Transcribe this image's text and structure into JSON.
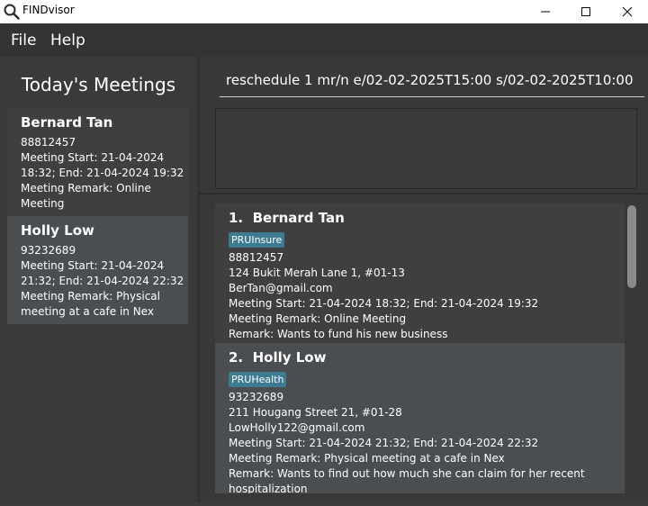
{
  "window": {
    "title": "FINDvisor"
  },
  "menu": {
    "file": "File",
    "help": "Help"
  },
  "meetings": {
    "title": "Today's Meetings",
    "items": [
      {
        "name": "Bernard Tan",
        "phone": "88812457",
        "time_line1": "Meeting Start: 21-04-2024",
        "time_line2": "18:32; End: 21-04-2024 19:32",
        "remark_line1": "Meeting Remark: Online",
        "remark_line2": "Meeting"
      },
      {
        "name": "Holly Low",
        "phone": "93232689",
        "time_line1": "Meeting Start: 21-04-2024",
        "time_line2": "21:32; End: 21-04-2024 22:32",
        "remark_line1": "Meeting Remark: Physical",
        "remark_line2": "meeting at a cafe in Nex"
      }
    ]
  },
  "command": {
    "value": "reschedule 1 mr/n e/02-02-2025T15:00 s/02-02-2025T10:00"
  },
  "result": {
    "text": ""
  },
  "persons": [
    {
      "index": "1.",
      "name": "Bernard Tan",
      "tag": "PRUInsure",
      "phone": "88812457",
      "address": "124 Bukit Merah Lane 1, #01-13",
      "email": "BerTan@gmail.com",
      "meeting": "Meeting Start: 21-04-2024 18:32; End: 21-04-2024 19:32",
      "meeting_remark": "Meeting Remark: Online Meeting",
      "remark_line1": "Remark: Wants to fund his new business",
      "remark_line2": ""
    },
    {
      "index": "2.",
      "name": "Holly Low",
      "tag": "PRUHealth",
      "phone": "93232689",
      "address": "211 Hougang Street 21, #01-28",
      "email": "LowHolly122@gmail.com",
      "meeting": "Meeting Start: 21-04-2024 21:32; End: 21-04-2024 22:32",
      "meeting_remark": "Meeting Remark: Physical meeting at a cafe in Nex",
      "remark_line1": "Remark: Wants to find out how much she can claim for her recent",
      "remark_line2": "hospitalization"
    }
  ],
  "colors": {
    "card_bg_dark": "#3f3f3f",
    "card_bg_light": "#4b4e51",
    "tag_bg": "#3e7b91"
  }
}
